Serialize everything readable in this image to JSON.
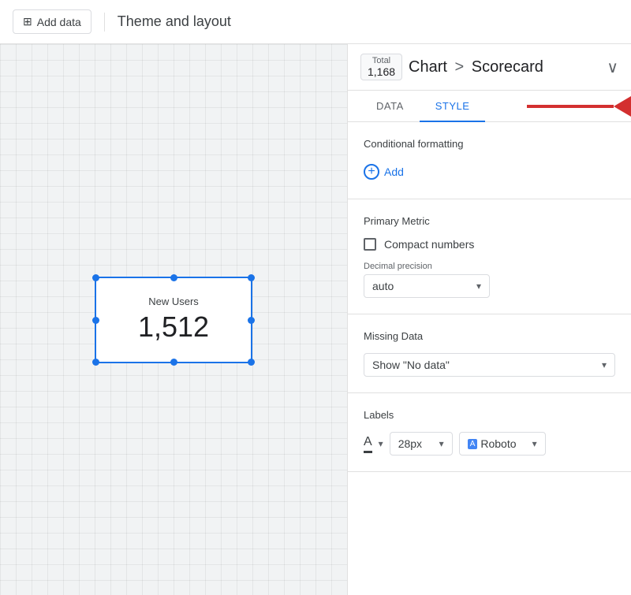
{
  "toolbar": {
    "add_data_label": "Add data",
    "theme_layout_label": "Theme and layout",
    "add_icon": "⊞"
  },
  "canvas": {
    "widget": {
      "label": "New Users",
      "value": "1,512"
    }
  },
  "panel": {
    "total_label": "Total",
    "total_value": "1,168",
    "breadcrumb_chart": "Chart",
    "breadcrumb_separator": ">",
    "breadcrumb_scorecard": "Scorecard",
    "collapse_icon": "∨",
    "tabs": [
      {
        "id": "data",
        "label": "DATA"
      },
      {
        "id": "style",
        "label": "STYLE"
      }
    ],
    "active_tab": "style",
    "sections": {
      "conditional_formatting": {
        "title": "Conditional formatting",
        "add_label": "Add"
      },
      "primary_metric": {
        "title": "Primary Metric",
        "compact_numbers_label": "Compact numbers",
        "decimal_precision_label": "Decimal precision",
        "decimal_value": "auto"
      },
      "missing_data": {
        "title": "Missing Data",
        "show_value": "Show \"No data\""
      },
      "labels": {
        "title": "Labels",
        "font_size": "28px",
        "font_name": "Roboto"
      }
    }
  }
}
